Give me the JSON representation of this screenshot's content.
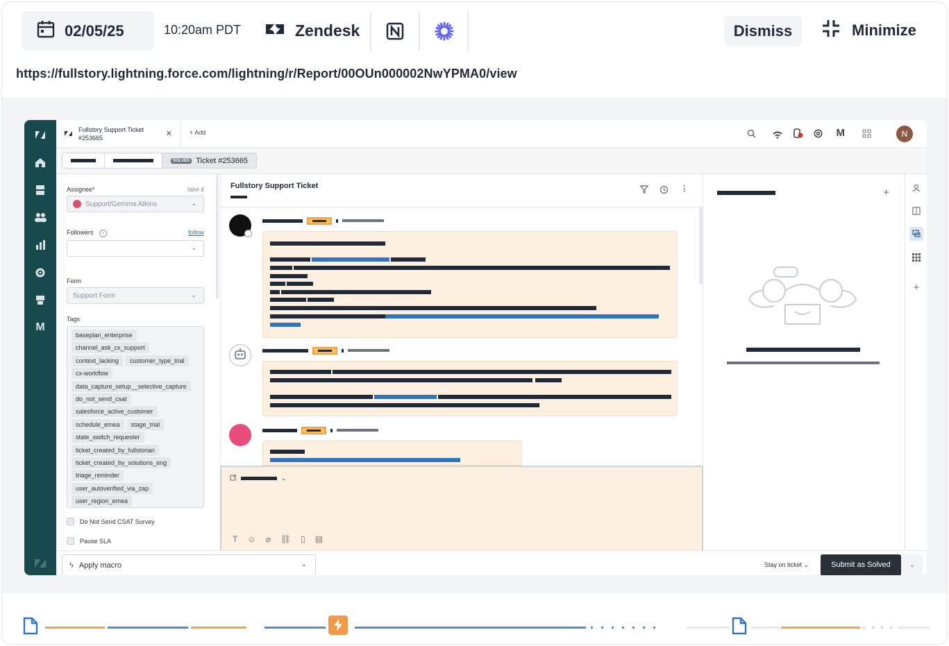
{
  "header": {
    "date": "02/05/25",
    "time": "10:20am PDT",
    "app_name": "Zendesk",
    "dismiss_label": "Dismiss",
    "minimize_label": "Minimize",
    "url": "https://fullstory.lightning.force.com/lightning/r/Report/00OUn000002NwYPMA0/view"
  },
  "app": {
    "tab_title_line1": "Fullstory Support Ticket",
    "tab_title_line2": "#253665",
    "add_tab_label": "+ Add",
    "avatar_initial": "N",
    "breadcrumb_badge": "SOLVED",
    "breadcrumb_ticket": "Ticket #253665",
    "assignee_label": "Assignee*",
    "take_it_label": "take it",
    "assignee_value": "Support/Gemma Atkins",
    "followers_label": "Followers",
    "follow_label": "follow",
    "form_label": "Form",
    "form_value": "Support Form",
    "tags_label": "Tags",
    "tags": [
      [
        "baseplan_enterprise"
      ],
      [
        "channel_ask_cx_support"
      ],
      [
        "context_lacking",
        "customer_type_trial"
      ],
      [
        "cx-workflow"
      ],
      [
        "data_capture_setup__selective_capture"
      ],
      [
        "do_not_send_csat"
      ],
      [
        "salesforce_active_customer"
      ],
      [
        "schedule_emea",
        "stage_trial"
      ],
      [
        "state_switch_requester"
      ],
      [
        "ticket_created_by_fullstorian"
      ],
      [
        "ticket_created_by_solutions_eng"
      ],
      [
        "triage_reminder"
      ],
      [
        "user_autoverified_via_zap"
      ],
      [
        "user_region_emea"
      ]
    ],
    "checkbox_csat": "Do Not Send CSAT Survey",
    "checkbox_sla": "Pause SLA",
    "conversation_title": "Fullstory Support Ticket",
    "apply_macro_label": "Apply macro",
    "stay_on_ticket_label": "Stay on ticket",
    "submit_label": "Submit as Solved"
  },
  "colors": {
    "rail": "#17494d",
    "accent_orange": "#f2a93b",
    "accent_blue": "#4a8fd6",
    "bubble": "#fdf0e0",
    "submit": "#2b3036"
  },
  "icons": [
    "calendar-icon",
    "zendesk-logo-icon",
    "notion-logo-icon",
    "asterisk-logo-icon",
    "minimize-icon",
    "file-icon",
    "bolt-icon"
  ]
}
